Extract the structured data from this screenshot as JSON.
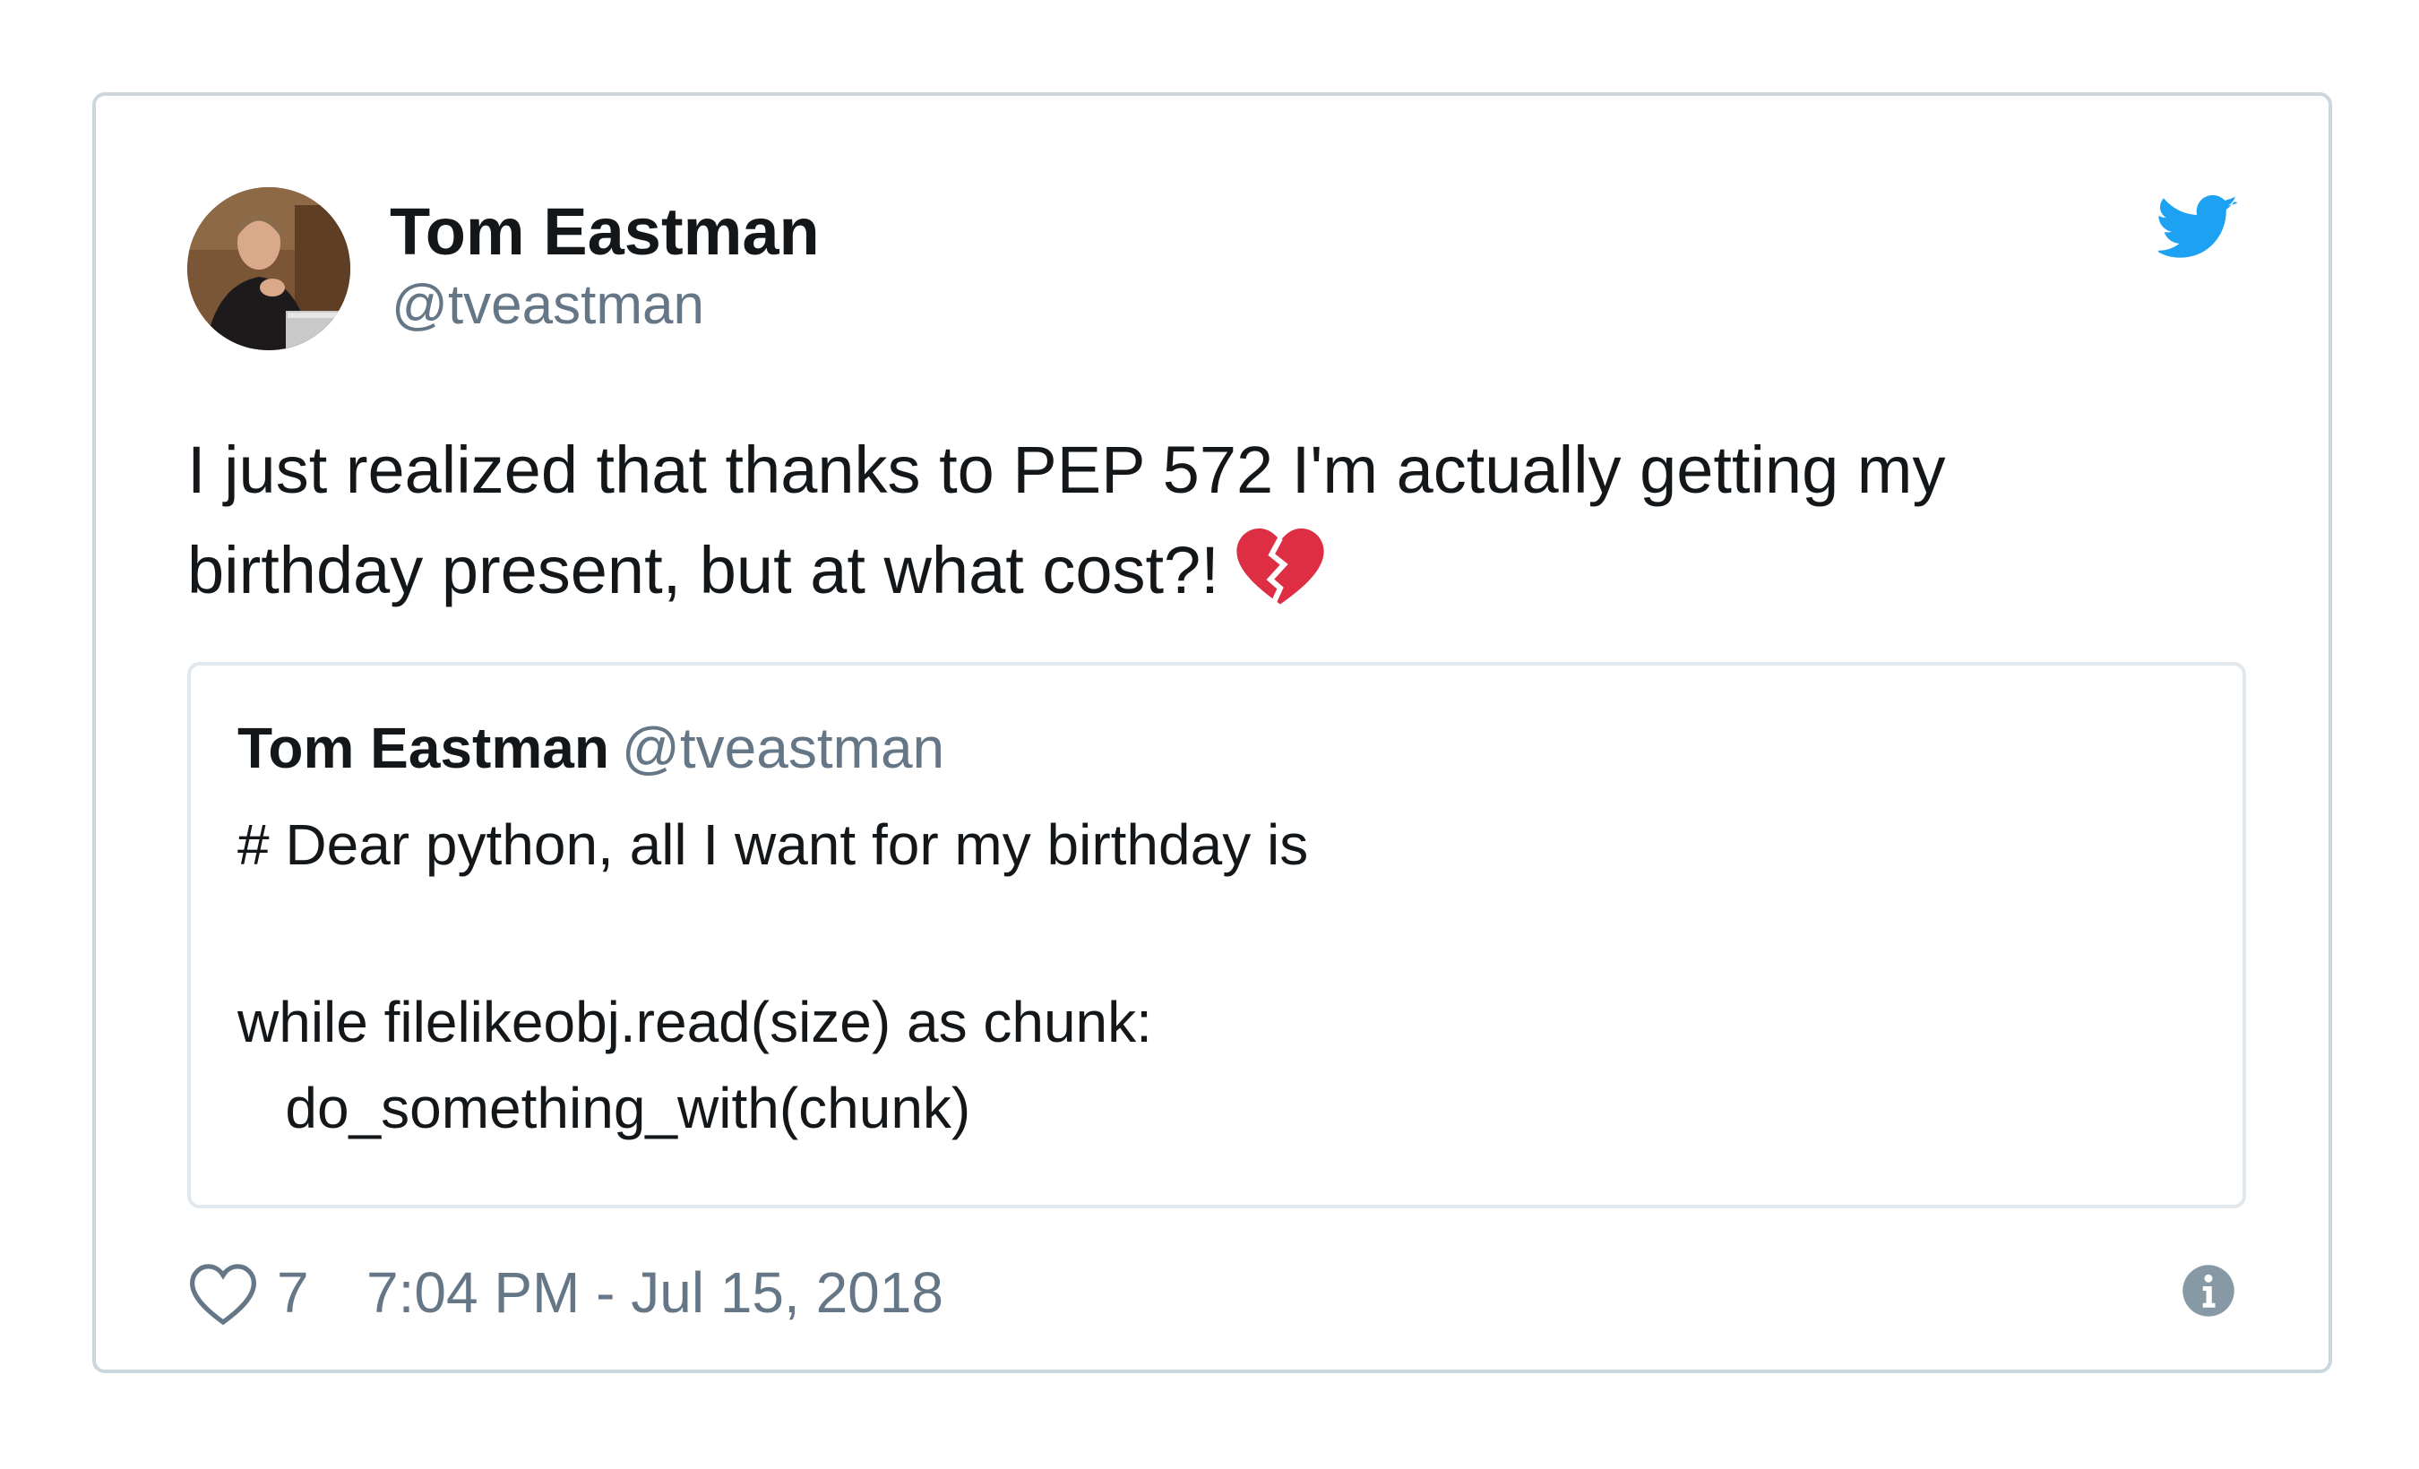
{
  "author": {
    "name": "Tom Eastman",
    "handle": "@tveastman"
  },
  "tweet": {
    "text_line_1": "I just realized that thanks to PEP 572 I'm actually getting my",
    "text_line_2": "birthday present, but at what cost?!",
    "emoji": "broken-heart-icon"
  },
  "quoted_tweet": {
    "name": "Tom Eastman",
    "handle": "@tveastman",
    "lines": [
      "# Dear python, all I want for my birthday is",
      "",
      "while filelikeobj.read(size) as chunk:",
      "   do_something_with(chunk)"
    ]
  },
  "footer": {
    "like_count": "7",
    "timestamp": "7:04 PM - Jul 15, 2018"
  },
  "icons": {
    "logo": "twitter-bird-icon",
    "like": "heart-outline-icon",
    "info": "info-icon"
  },
  "colors": {
    "twitter_blue": "#1da1f2",
    "secondary_text": "#657786",
    "border": "#ccd6dd",
    "broken_heart": "#dd2e44"
  }
}
